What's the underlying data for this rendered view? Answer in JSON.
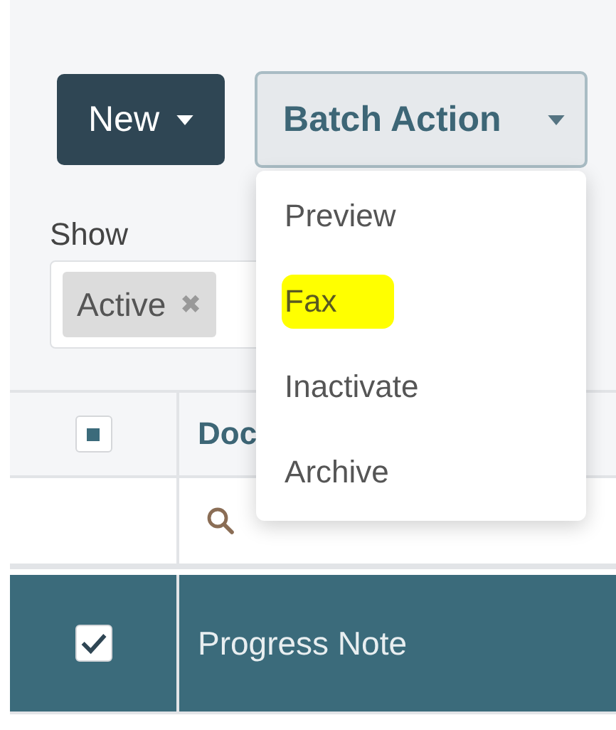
{
  "toolbar": {
    "buttons": [
      {
        "label": "New",
        "kind": "primary"
      },
      {
        "label": "Batch Action",
        "kind": "secondary"
      }
    ]
  },
  "batch_menu": {
    "open": true,
    "items": [
      {
        "label": "Preview",
        "highlighted": false
      },
      {
        "label": "Fax",
        "highlighted": true
      },
      {
        "label": "Inactivate",
        "highlighted": false
      },
      {
        "label": "Archive",
        "highlighted": false
      }
    ]
  },
  "filter": {
    "label": "Show",
    "tags": [
      {
        "label": "Active",
        "remove": "✖"
      }
    ]
  },
  "table": {
    "select_all": {
      "indeterminate": true
    },
    "columns": [
      {
        "label": "Doc"
      }
    ],
    "rows": [
      {
        "selected": true,
        "checked": true,
        "cells": [
          "Progress Note"
        ]
      }
    ]
  }
}
